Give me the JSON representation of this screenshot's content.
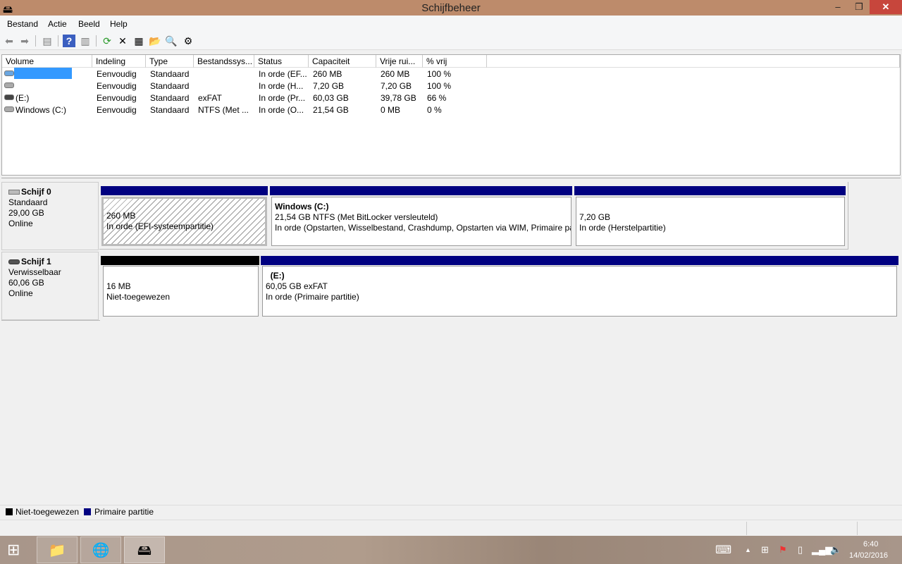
{
  "window": {
    "title": "Schijfbeheer",
    "minimize": "–",
    "maximize": "❐",
    "close": "✕"
  },
  "menu": [
    "Bestand",
    "Actie",
    "Beeld",
    "Help"
  ],
  "toolbar_icons": [
    "back-icon",
    "forward-icon",
    "show-hide-console-tree-icon",
    "help-icon",
    "show-action-pane-icon",
    "refresh-icon",
    "delete-icon",
    "properties-icon",
    "open-icon",
    "explore-icon",
    "settings-icon"
  ],
  "columns": [
    "Volume",
    "Indeling",
    "Type",
    "Bestandssys...",
    "Status",
    "Capaciteit",
    "Vrije rui...",
    "% vrij"
  ],
  "volumes": [
    {
      "volume": "",
      "indeling": "Eenvoudig",
      "type": "Standaard",
      "fs": "",
      "status": "In orde (EF...",
      "cap": "260 MB",
      "free": "260 MB",
      "pct": "100 %"
    },
    {
      "volume": "",
      "indeling": "Eenvoudig",
      "type": "Standaard",
      "fs": "",
      "status": "In orde (H...",
      "cap": "7,20 GB",
      "free": "7,20 GB",
      "pct": "100 %"
    },
    {
      "volume": "(E:)",
      "indeling": "Eenvoudig",
      "type": "Standaard",
      "fs": "exFAT",
      "status": "In orde (Pr...",
      "cap": "60,03 GB",
      "free": "39,78 GB",
      "pct": "66 %"
    },
    {
      "volume": "Windows (C:)",
      "indeling": "Eenvoudig",
      "type": "Standaard",
      "fs": "NTFS (Met ...",
      "status": "In orde (O...",
      "cap": "21,54 GB",
      "free": "0 MB",
      "pct": "0 %"
    }
  ],
  "disks": [
    {
      "name": "Schijf 0",
      "type": "Standaard",
      "size": "29,00 GB",
      "state": "Online",
      "partitions": [
        {
          "title": "",
          "line1": "260 MB",
          "line2": "In orde (EFI-systeempartitie)"
        },
        {
          "title": "Windows  (C:)",
          "line1": "21,54 GB NTFS (Met BitLocker versleuteld)",
          "line2": "In orde (Opstarten, Wisselbestand, Crashdump, Opstarten via WIM, Primaire pa"
        },
        {
          "title": "",
          "line1": "7,20 GB",
          "line2": "In orde (Herstelpartitie)"
        }
      ]
    },
    {
      "name": "Schijf 1",
      "type": "Verwisselbaar",
      "size": "60,06 GB",
      "state": "Online",
      "partitions": [
        {
          "title": "",
          "line1": "16 MB",
          "line2": "Niet-toegewezen"
        },
        {
          "title": "(E:)",
          "line1": "60,05 GB exFAT",
          "line2": "In orde (Primaire partitie)"
        }
      ]
    }
  ],
  "legend": [
    {
      "label": "Niet-toegewezen",
      "color": "#000000"
    },
    {
      "label": "Primaire partitie",
      "color": "#000080"
    }
  ],
  "taskbar": {
    "time": "6:40",
    "date": "14/02/2016"
  }
}
